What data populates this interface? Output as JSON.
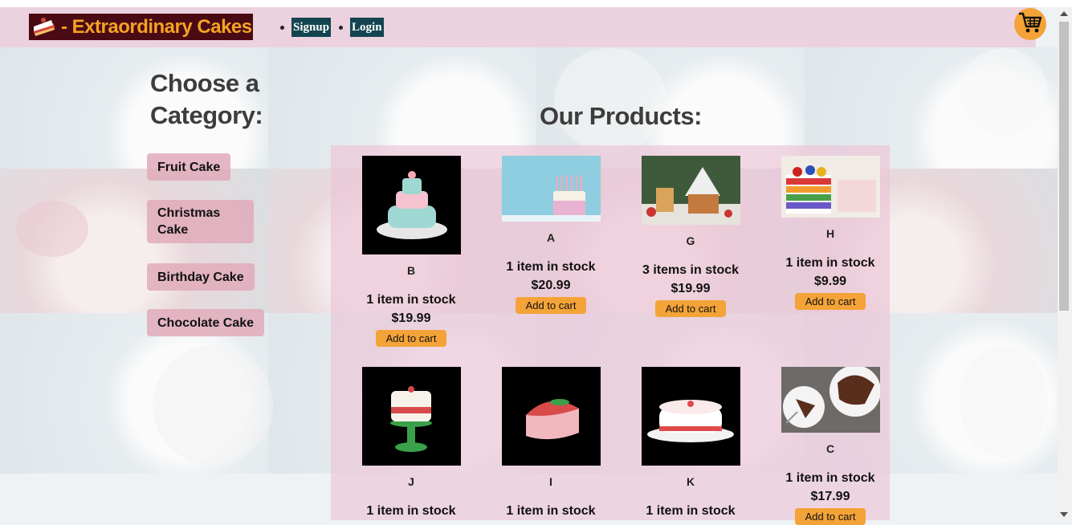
{
  "brand": {
    "title": "- Extraordinary Cakes"
  },
  "nav": {
    "signup": "Signup",
    "login": "Login"
  },
  "icons": {
    "cart": "shopping-cart-icon",
    "logo": "cake-slice-icon"
  },
  "colors": {
    "accent": "#f4a338",
    "nav_link_bg": "#12454f",
    "logo_bg": "#4a0a14",
    "logo_text": "#f4a223",
    "panel": "#ecc4d6"
  },
  "sidebar": {
    "title": "Choose a Category:",
    "categories": [
      "Fruit Cake",
      "Christmas Cake",
      "Birthday Cake",
      "Chocolate Cake"
    ]
  },
  "main": {
    "title": "Our Products:"
  },
  "products": [
    {
      "name": "B",
      "stock": "1 item in stock",
      "price": "$19.99",
      "button": "Add to cart"
    },
    {
      "name": "A",
      "stock": "1 item in stock",
      "price": "$20.99",
      "button": "Add to cart"
    },
    {
      "name": "G",
      "stock": "3 items in stock",
      "price": "$19.99",
      "button": "Add to cart"
    },
    {
      "name": "H",
      "stock": "1 item in stock",
      "price": "$9.99",
      "button": "Add to cart"
    },
    {
      "name": "J",
      "stock": "1 item in stock"
    },
    {
      "name": "I",
      "stock": "1 item in stock"
    },
    {
      "name": "K",
      "stock": "1 item in stock"
    },
    {
      "name": "C",
      "stock": "1 item in stock",
      "price": "$17.99",
      "button": "Add to cart"
    }
  ]
}
